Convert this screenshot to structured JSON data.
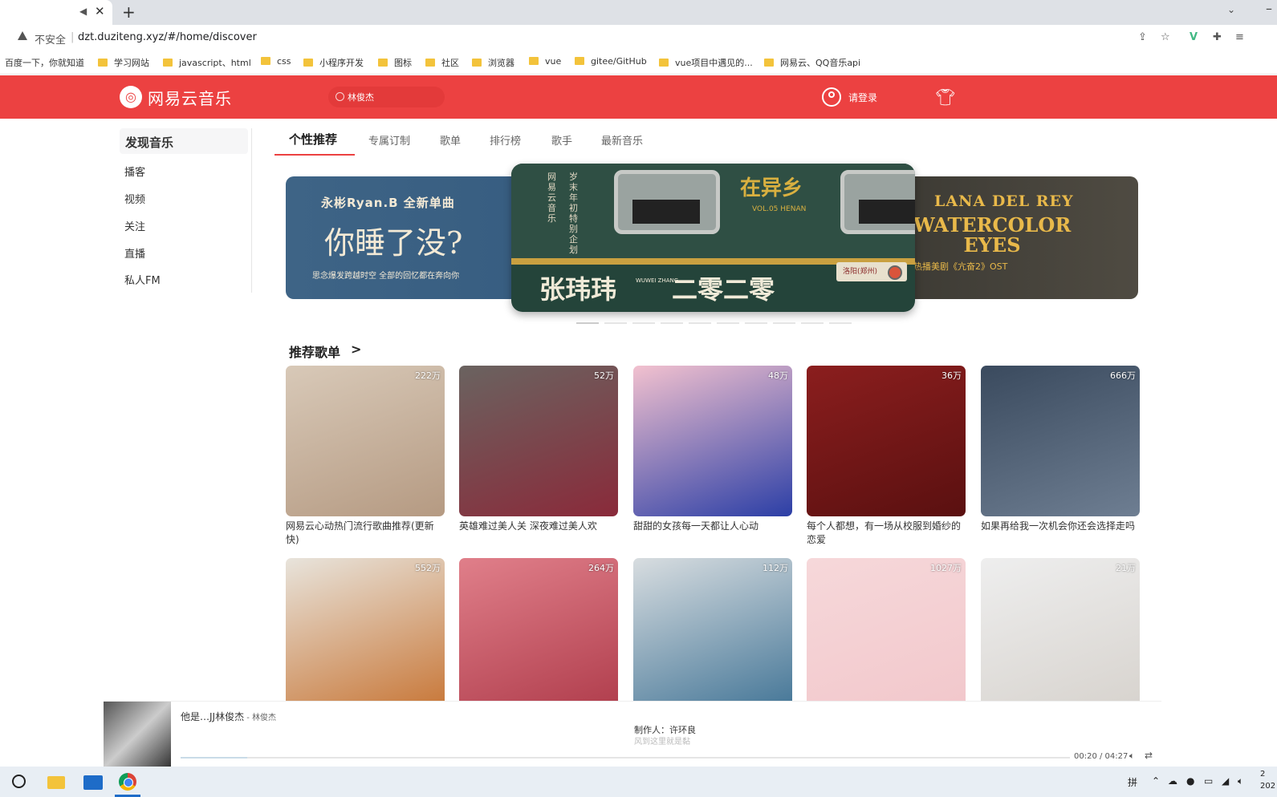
{
  "browser": {
    "tab": {
      "mute_icon": "speaker-icon",
      "close_glyph": "✕"
    },
    "new_tab_glyph": "+",
    "address": {
      "insecure_label": "不安全",
      "url": "dzt.duziteng.xyz/#/home/discover"
    },
    "bookmarks": [
      {
        "label": "百度一下，你就知道",
        "folder": false
      },
      {
        "label": "学习网站",
        "folder": true
      },
      {
        "label": "javascript、html",
        "folder": true
      },
      {
        "label": "css",
        "folder": true
      },
      {
        "label": "小程序开发",
        "folder": true
      },
      {
        "label": "图标",
        "folder": true
      },
      {
        "label": "社区",
        "folder": true
      },
      {
        "label": "浏览器",
        "folder": true
      },
      {
        "label": "vue",
        "folder": true
      },
      {
        "label": "gitee/GitHub",
        "folder": true
      },
      {
        "label": "vue项目中遇见的...",
        "folder": true
      },
      {
        "label": "网易云、QQ音乐api",
        "folder": true
      }
    ]
  },
  "header": {
    "logo_text": "网易云音乐",
    "search_value": "林俊杰",
    "login_label": "请登录"
  },
  "sidebar": {
    "active": "发现音乐",
    "items": [
      "播客",
      "视频",
      "关注",
      "直播",
      "私人FM"
    ]
  },
  "tabs": [
    "个性推荐",
    "专属订制",
    "歌单",
    "排行榜",
    "歌手",
    "最新音乐"
  ],
  "banner": {
    "left": {
      "line1": "永彬Ryan.B   全新单曲",
      "line2": "你睡了没?",
      "line3": "思念爆发跨越时空  全部的回忆都在奔向你"
    },
    "center": {
      "vertical1": "网易云音乐",
      "vertical2": "岁末年初特别企划",
      "title": "在异乡",
      "vol": "VOL.05 HENAN",
      "name": "张玮玮",
      "name_en": "WUWEI ZHANG",
      "subtitle": "二零二零",
      "plate": "洛阳(郑州)"
    },
    "right": {
      "line1": "LANA DEL REY",
      "line2": "WATERCOLOR EYES",
      "line3": "热播美剧《亢奋2》OST"
    },
    "dot_count": 10,
    "active_dot": 0
  },
  "section_title": "推荐歌单",
  "section_chevron": ">",
  "playlists": [
    {
      "count": "222万",
      "name": "网易云心动热门流行歌曲推荐(更新快)",
      "colors": [
        "#d8c9b8",
        "#b59a82"
      ]
    },
    {
      "count": "52万",
      "name": "英雄难过美人关 深夜难过美人欢",
      "colors": [
        "#6a6360",
        "#8a2a3a"
      ]
    },
    {
      "count": "48万",
      "name": "甜甜的女孩每一天都让人心动",
      "colors": [
        "#f2c1cf",
        "#2c3fa6"
      ]
    },
    {
      "count": "36万",
      "name": "每个人都想，有一场从校服到婚纱的恋爱",
      "colors": [
        "#8b1e1e",
        "#5a1010"
      ]
    },
    {
      "count": "666万",
      "name": "如果再给我一次机会你还会选择走吗",
      "colors": [
        "#3a4a5e",
        "#6e7e92"
      ]
    },
    {
      "count": "552万",
      "name": "",
      "colors": [
        "#e8e4dc",
        "#c97b3e"
      ]
    },
    {
      "count": "264万",
      "name": "",
      "colors": [
        "#e07f8a",
        "#b2404f"
      ]
    },
    {
      "count": "112万",
      "name": "",
      "colors": [
        "#d8dde0",
        "#4a7a9a"
      ]
    },
    {
      "count": "1027万",
      "name": "",
      "colors": [
        "#f6d8da",
        "#f2c8cc"
      ]
    },
    {
      "count": "21万",
      "name": "",
      "colors": [
        "#eeeeee",
        "#d8d4cf"
      ]
    }
  ],
  "player": {
    "title": "他是…JJ林俊杰",
    "artist": " - 林俊杰",
    "lyric": "制作人：许环良",
    "lyric_next": "风到这里就是黏",
    "time": "00:20 / 04:27",
    "progress": 0.075
  },
  "taskbar": {
    "clock": "2\n202"
  },
  "colors": {
    "brand": "#ec4141"
  }
}
